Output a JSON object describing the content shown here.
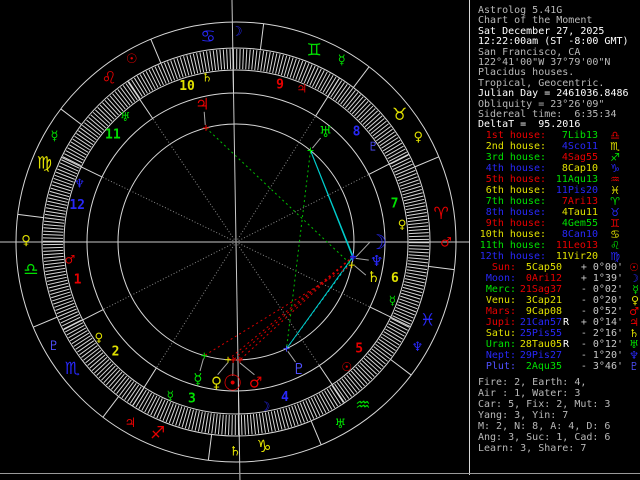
{
  "app": {
    "name": "Astrolog",
    "header_lines": [
      {
        "text": "Astrolog 5.41G",
        "tone": "gray"
      },
      {
        "text": "Chart of the Moment",
        "tone": "gray"
      },
      {
        "text": "Sat December 27, 2025",
        "tone": "white"
      },
      {
        "text": "12:22:00am (ST -8:00 GMT)",
        "tone": "white"
      },
      {
        "text": "San Francisco, CA",
        "tone": "gray"
      },
      {
        "text": "122°41'00\"W 37°79'00\"N",
        "tone": "gray"
      },
      {
        "text": "Placidus houses.",
        "tone": "gray"
      },
      {
        "text": "Tropical, Geocentric.",
        "tone": "gray"
      },
      {
        "text": "Julian Day = 2461036.8486",
        "tone": "white"
      },
      {
        "text": "Obliquity = 23°26'09\"",
        "tone": "gray"
      },
      {
        "text": "Sidereal time:  6:35:34",
        "tone": "gray"
      },
      {
        "text": "DeltaT =  95.2016",
        "tone": "white"
      }
    ]
  },
  "houses_table": {
    "rows": [
      {
        "label": "1st house:",
        "value": "7Lib13",
        "glyph": "♎",
        "label_color": "#e80000",
        "value_color": "#00e000",
        "glyph_color": "#e80000"
      },
      {
        "label": "2nd house:",
        "value": "4Sco11",
        "glyph": "♏",
        "label_color": "#e0e000",
        "value_color": "#2828f8",
        "glyph_color": "#e0e000"
      },
      {
        "label": "3rd house:",
        "value": "4Sag55",
        "glyph": "♐",
        "label_color": "#00e000",
        "value_color": "#e80000",
        "glyph_color": "#00e000"
      },
      {
        "label": "4th house:",
        "value": "8Cap10",
        "glyph": "♑",
        "label_color": "#2828f8",
        "value_color": "#e0e000",
        "glyph_color": "#2828f8"
      },
      {
        "label": "5th house:",
        "value": "11Aqu13",
        "glyph": "♒",
        "label_color": "#e80000",
        "value_color": "#00e000",
        "glyph_color": "#e80000"
      },
      {
        "label": "6th house:",
        "value": "11Pis20",
        "glyph": "♓",
        "label_color": "#e0e000",
        "value_color": "#2828f8",
        "glyph_color": "#e0e000"
      },
      {
        "label": "7th house:",
        "value": "7Ari13",
        "glyph": "♈",
        "label_color": "#00e000",
        "value_color": "#e80000",
        "glyph_color": "#00e000"
      },
      {
        "label": "8th house:",
        "value": "4Tau11",
        "glyph": "♉",
        "label_color": "#2828f8",
        "value_color": "#e0e000",
        "glyph_color": "#2828f8"
      },
      {
        "label": "9th house:",
        "value": "4Gem55",
        "glyph": "♊",
        "label_color": "#e80000",
        "value_color": "#00e000",
        "glyph_color": "#e80000"
      },
      {
        "label": "10th house:",
        "value": "8Can10",
        "glyph": "♋",
        "label_color": "#e0e000",
        "value_color": "#2828f8",
        "glyph_color": "#e0e000"
      },
      {
        "label": "11th house:",
        "value": "11Leo13",
        "glyph": "♌",
        "label_color": "#00e000",
        "value_color": "#e80000",
        "glyph_color": "#00e000"
      },
      {
        "label": "12th house:",
        "value": "11Vir20",
        "glyph": "♍",
        "label_color": "#2828f8",
        "value_color": "#e0e000",
        "glyph_color": "#2828f8"
      }
    ]
  },
  "planets_table": {
    "rows": [
      {
        "label": "Sun:",
        "value": "5Cap50",
        "retro": "",
        "delta": "+ 0°00'",
        "glyph": "☉",
        "label_color": "#e80000",
        "value_color": "#e0e000",
        "glyph_color": "#e80000"
      },
      {
        "label": "Moon:",
        "value": "0Ari12",
        "retro": "",
        "delta": "+ 1°39'",
        "glyph": "☽",
        "label_color": "#2828f8",
        "value_color": "#e80000",
        "glyph_color": "#2828f8"
      },
      {
        "label": "Merc:",
        "value": "21Sag37",
        "retro": "",
        "delta": "- 0°02'",
        "glyph": "☿",
        "label_color": "#00e000",
        "value_color": "#e80000",
        "glyph_color": "#00e000"
      },
      {
        "label": "Venu:",
        "value": "3Cap21",
        "retro": "",
        "delta": "- 0°20'",
        "glyph": "♀",
        "label_color": "#e0e000",
        "value_color": "#e0e000",
        "glyph_color": "#e0e000"
      },
      {
        "label": "Mars:",
        "value": "9Cap08",
        "retro": "",
        "delta": "- 0°52'",
        "glyph": "♂",
        "label_color": "#e80000",
        "value_color": "#e0e000",
        "glyph_color": "#e80000"
      },
      {
        "label": "Jupi:",
        "value": "21Can57",
        "retro": "R",
        "delta": "+ 0°14'",
        "glyph": "♃",
        "label_color": "#e80000",
        "value_color": "#2828f8",
        "glyph_color": "#e80000"
      },
      {
        "label": "Satu:",
        "value": "25Pis55",
        "retro": "",
        "delta": "- 2°16'",
        "glyph": "♄",
        "label_color": "#e0e000",
        "value_color": "#2828f8",
        "glyph_color": "#e0e000"
      },
      {
        "label": "Uran:",
        "value": "28Tau05",
        "retro": "R",
        "delta": "- 0°12'",
        "glyph": "♅",
        "label_color": "#00e000",
        "value_color": "#e0e000",
        "glyph_color": "#00e000"
      },
      {
        "label": "Nept:",
        "value": "29Pis27",
        "retro": "",
        "delta": "- 1°20'",
        "glyph": "♆",
        "label_color": "#2828f8",
        "value_color": "#2828f8",
        "glyph_color": "#2828f8"
      },
      {
        "label": "Plut:",
        "value": "2Aqu35",
        "retro": "",
        "delta": "- 3°46'",
        "glyph": "♇",
        "label_color": "#5050ff",
        "value_color": "#00e000",
        "glyph_color": "#5050ff"
      }
    ]
  },
  "stats": {
    "lines": [
      "Fire: 2, Earth: 4,",
      "Air : 1, Water: 3",
      "Car: 5, Fix: 2, Mut: 3",
      "Yang: 3, Yin: 7",
      "M: 2, N: 8, A: 4, D: 6",
      "Ang: 3, Suc: 1, Cad: 6",
      "Learn: 3, Share: 7"
    ]
  },
  "chart_data": {
    "type": "astrology-wheel",
    "ascendant_lon": 187.22,
    "house_cusps_lon": [
      187.22,
      214.18,
      244.92,
      278.17,
      311.22,
      341.33,
      7.22,
      34.18,
      64.92,
      98.17,
      131.22,
      161.33
    ],
    "house_number_colors": [
      "#e80000",
      "#e0e000",
      "#00e000",
      "#2828f8"
    ],
    "house_rulers": [
      {
        "glyph": "♂",
        "color": "#e80000"
      },
      {
        "glyph": "♀",
        "color": "#e0e000"
      },
      {
        "glyph": "☿",
        "color": "#00e000"
      },
      {
        "glyph": "☽",
        "color": "#2828f8"
      },
      {
        "glyph": "☉",
        "color": "#e80000"
      },
      {
        "glyph": "☿",
        "color": "#00e000"
      },
      {
        "glyph": "♀",
        "color": "#e0e000"
      },
      {
        "glyph": "♇",
        "color": "#5050ff"
      },
      {
        "glyph": "♃",
        "color": "#e80000"
      },
      {
        "glyph": "♄",
        "color": "#e0e000"
      },
      {
        "glyph": "♅",
        "color": "#00e000"
      },
      {
        "glyph": "♆",
        "color": "#2828f8"
      }
    ],
    "signs": [
      {
        "name": "aries",
        "glyph": "♈",
        "color": "#e80000",
        "ruler_glyph": "♂",
        "ruler_color": "#e80000"
      },
      {
        "name": "taurus",
        "glyph": "♉",
        "color": "#e0e000",
        "ruler_glyph": "♀",
        "ruler_color": "#e0e000"
      },
      {
        "name": "gemini",
        "glyph": "♊",
        "color": "#00e000",
        "ruler_glyph": "☿",
        "ruler_color": "#00e000"
      },
      {
        "name": "cancer",
        "glyph": "♋",
        "color": "#2828f8",
        "ruler_glyph": "☽",
        "ruler_color": "#2828f8"
      },
      {
        "name": "leo",
        "glyph": "♌",
        "color": "#e80000",
        "ruler_glyph": "☉",
        "ruler_color": "#e80000"
      },
      {
        "name": "virgo",
        "glyph": "♍",
        "color": "#e0e000",
        "ruler_glyph": "☿",
        "ruler_color": "#00e000"
      },
      {
        "name": "libra",
        "glyph": "♎",
        "color": "#00e000",
        "ruler_glyph": "♀",
        "ruler_color": "#e0e000"
      },
      {
        "name": "scorpio",
        "glyph": "♏",
        "color": "#2828f8",
        "ruler_glyph": "♇",
        "ruler_color": "#5050ff"
      },
      {
        "name": "sagittarius",
        "glyph": "♐",
        "color": "#e80000",
        "ruler_glyph": "♃",
        "ruler_color": "#e80000"
      },
      {
        "name": "capricorn",
        "glyph": "♑",
        "color": "#e0e000",
        "ruler_glyph": "♄",
        "ruler_color": "#e0e000"
      },
      {
        "name": "aquarius",
        "glyph": "♒",
        "color": "#00e000",
        "ruler_glyph": "♅",
        "ruler_color": "#00e000"
      },
      {
        "name": "pisces",
        "glyph": "♓",
        "color": "#2828f8",
        "ruler_glyph": "♆",
        "ruler_color": "#2828f8"
      }
    ],
    "planets": [
      {
        "name": "sun",
        "glyph": "☉",
        "color": "#e80000",
        "lon": 275.83,
        "size": 22,
        "adj": 0
      },
      {
        "name": "moon",
        "glyph": "☽",
        "color": "#2828f8",
        "lon": 0.2,
        "size": 20,
        "adj": 7
      },
      {
        "name": "mercury",
        "glyph": "☿",
        "color": "#00e000",
        "lon": 261.62,
        "size": 15,
        "adj": 0
      },
      {
        "name": "venus",
        "glyph": "♀",
        "color": "#e0e000",
        "lon": 273.35,
        "size": 15,
        "adj": -4
      },
      {
        "name": "mars",
        "glyph": "♂",
        "color": "#e80000",
        "lon": 279.13,
        "size": 15,
        "adj": 6
      },
      {
        "name": "jupiter",
        "glyph": "♃",
        "color": "#e80000",
        "lon": 111.95,
        "size": 16,
        "adj": -1
      },
      {
        "name": "saturn",
        "glyph": "♄",
        "color": "#e0e000",
        "lon": 355.92,
        "size": 15,
        "adj": -3
      },
      {
        "name": "uranus",
        "glyph": "♅",
        "color": "#00e000",
        "lon": 58.08,
        "size": 15,
        "adj": 0
      },
      {
        "name": "neptune",
        "glyph": "♆",
        "color": "#2828f8",
        "lon": 359.45,
        "size": 15,
        "adj": 0
      },
      {
        "name": "pluto",
        "glyph": "♇",
        "color": "#5050ff",
        "lon": 302.58,
        "size": 15,
        "adj": 1
      }
    ],
    "aspects": [
      {
        "a": "uranus",
        "b": "moon",
        "color": "#00cccc",
        "style": "solid"
      },
      {
        "a": "uranus",
        "b": "neptune",
        "color": "#00cccc",
        "style": "solid"
      },
      {
        "a": "moon",
        "b": "pluto",
        "color": "#00cccc",
        "style": "solid"
      },
      {
        "a": "neptune",
        "b": "pluto",
        "color": "#00cccc",
        "style": "dotted"
      },
      {
        "a": "uranus",
        "b": "pluto",
        "color": "#00c000",
        "style": "dotted"
      },
      {
        "a": "jupiter",
        "b": "saturn",
        "color": "#00c000",
        "style": "dotted"
      },
      {
        "a": "moon",
        "b": "sun",
        "color": "#d80000",
        "style": "dotted"
      },
      {
        "a": "moon",
        "b": "venus",
        "color": "#d80000",
        "style": "dotted"
      },
      {
        "a": "moon",
        "b": "mars",
        "color": "#d80000",
        "style": "dotted"
      },
      {
        "a": "saturn",
        "b": "mercury",
        "color": "#d80000",
        "style": "dotted"
      },
      {
        "a": "sun",
        "b": "venus",
        "color": "#e0e000",
        "style": "solid"
      }
    ]
  },
  "colors": {
    "white": "#ffffff",
    "gray": "#b8b8b8",
    "wheel_line": "#d8d8d8",
    "axis": "#c8c8c8",
    "cusp_dotted": "#8a8a8a",
    "pointer": "#a8a8a8"
  }
}
